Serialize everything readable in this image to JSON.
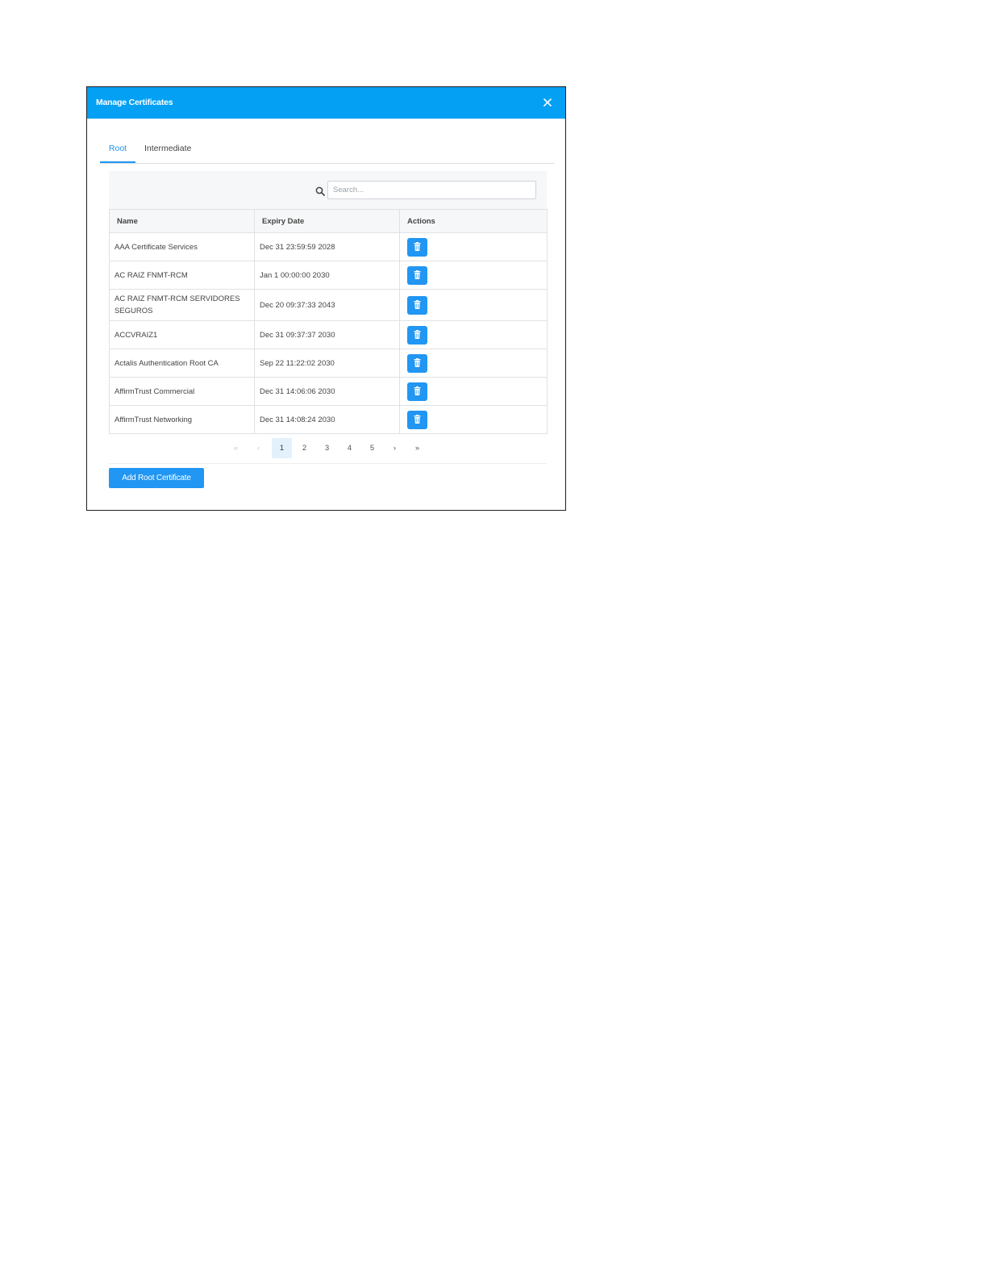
{
  "dialog": {
    "title": "Manage Certificates"
  },
  "tabs": [
    {
      "label": "Root",
      "active": true
    },
    {
      "label": "Intermediate",
      "active": false
    }
  ],
  "search": {
    "placeholder": "Search...",
    "value": ""
  },
  "table": {
    "columns": [
      "Name",
      "Expiry Date",
      "Actions"
    ],
    "rows": [
      {
        "name": "AAA Certificate Services",
        "expiry": "Dec 31 23:59:59 2028"
      },
      {
        "name": "AC RAIZ FNMT-RCM",
        "expiry": "Jan 1 00:00:00 2030"
      },
      {
        "name": "AC RAIZ FNMT-RCM SERVIDORES SEGUROS",
        "expiry": "Dec 20 09:37:33 2043"
      },
      {
        "name": "ACCVRAIZ1",
        "expiry": "Dec 31 09:37:37 2030"
      },
      {
        "name": "Actalis Authentication Root CA",
        "expiry": "Sep 22 11:22:02 2030"
      },
      {
        "name": "AffirmTrust Commercial",
        "expiry": "Dec 31 14:06:06 2030"
      },
      {
        "name": "AffirmTrust Networking",
        "expiry": "Dec 31 14:08:24 2030"
      }
    ],
    "row_action_icon": "trash-icon"
  },
  "pagination": {
    "first": "«",
    "prev": "‹",
    "pages": [
      "1",
      "2",
      "3",
      "4",
      "5"
    ],
    "current": "1",
    "next": "›",
    "last": "»"
  },
  "footer": {
    "add_button_label": "Add Root Certificate"
  },
  "colors": {
    "header": "#03a0f4",
    "accent": "#2196f3"
  }
}
